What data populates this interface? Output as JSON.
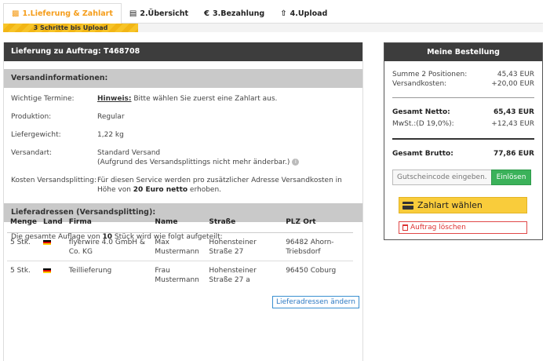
{
  "tabs": [
    {
      "label": "1.Lieferung & Zahlart",
      "icon": "truck-icon",
      "active": true
    },
    {
      "label": "2.Übersicht",
      "icon": "list-icon"
    },
    {
      "label": "3.Bezahlung",
      "icon": "euro-icon"
    },
    {
      "label": "4.Upload",
      "icon": "upload-icon"
    }
  ],
  "progress": {
    "label": "3 Schritte bis Upload"
  },
  "order": {
    "header": "Lieferung zu Auftrag: T468708",
    "shipping_section": "Versandinformationen:",
    "rows": {
      "dates_label": "Wichtige Termine:",
      "dates_hint": "Hinweis:",
      "dates_text": " Bitte wählen Sie zuerst eine Zahlart aus.",
      "production_label": "Produktion:",
      "production_value": "Regular",
      "weight_label": "Liefergewicht:",
      "weight_value": "1,22 kg",
      "shipping_label": "Versandart:",
      "shipping_value": "Standard Versand",
      "shipping_note": "(Aufgrund des Versandsplittings nicht mehr änderbar.)",
      "cost_label": "Kosten Versandsplitting:",
      "cost_text_1": "Für diesen Service werden pro zusätzlicher Adresse Versandkosten in Höhe von ",
      "cost_amount": "20 Euro netto",
      "cost_text_2": " erhoben."
    },
    "address_section": "Lieferadressen (Versandsplitting):",
    "split_text_1": "Die gesamte Auflage von ",
    "split_qty": "10",
    "split_text_2": " Stück wird wie folgt aufgeteilt:",
    "table": {
      "headers": [
        "Menge",
        "Land",
        "Firma",
        "Name",
        "Straße",
        "PLZ Ort"
      ],
      "rows": [
        {
          "qty": "5 Stk.",
          "company": "flyerwire 4.0 GmbH & Co. KG",
          "name": "Max Mustermann",
          "street": "Hohensteiner Straße 27",
          "city": "96482 Ahorn-Triebsdorf"
        },
        {
          "qty": "5 Stk.",
          "company": "Teillieferung",
          "name": "Frau Mustermann",
          "street": "Hohensteiner Straße 27 a",
          "city": "96450 Coburg"
        }
      ]
    },
    "change_button": "Lieferadressen ändern"
  },
  "summary": {
    "header": "Meine Bestellung",
    "sum_label": "Summe 2 Positionen:",
    "sum_value": "45,43 EUR",
    "shipping_label": "Versandkosten:",
    "shipping_value": "+20,00 EUR",
    "net_label": "Gesamt Netto:",
    "net_value": "65,43 EUR",
    "vat_label": "MwSt.:(D 19,0%):",
    "vat_value": "+12,43 EUR",
    "gross_label": "Gesamt Brutto:",
    "gross_value": "77,86 EUR",
    "voucher_placeholder": "Gutscheincode eingeben..",
    "voucher_button": "Einlösen",
    "pay_button": "Zahlart wählen",
    "delete_button": "Auftrag löschen"
  },
  "colors": {
    "accent": "#f59d1a",
    "dark": "#3d3d3d",
    "green": "#3bb25a",
    "yellow": "#f9cc3b",
    "red": "#e04848"
  }
}
